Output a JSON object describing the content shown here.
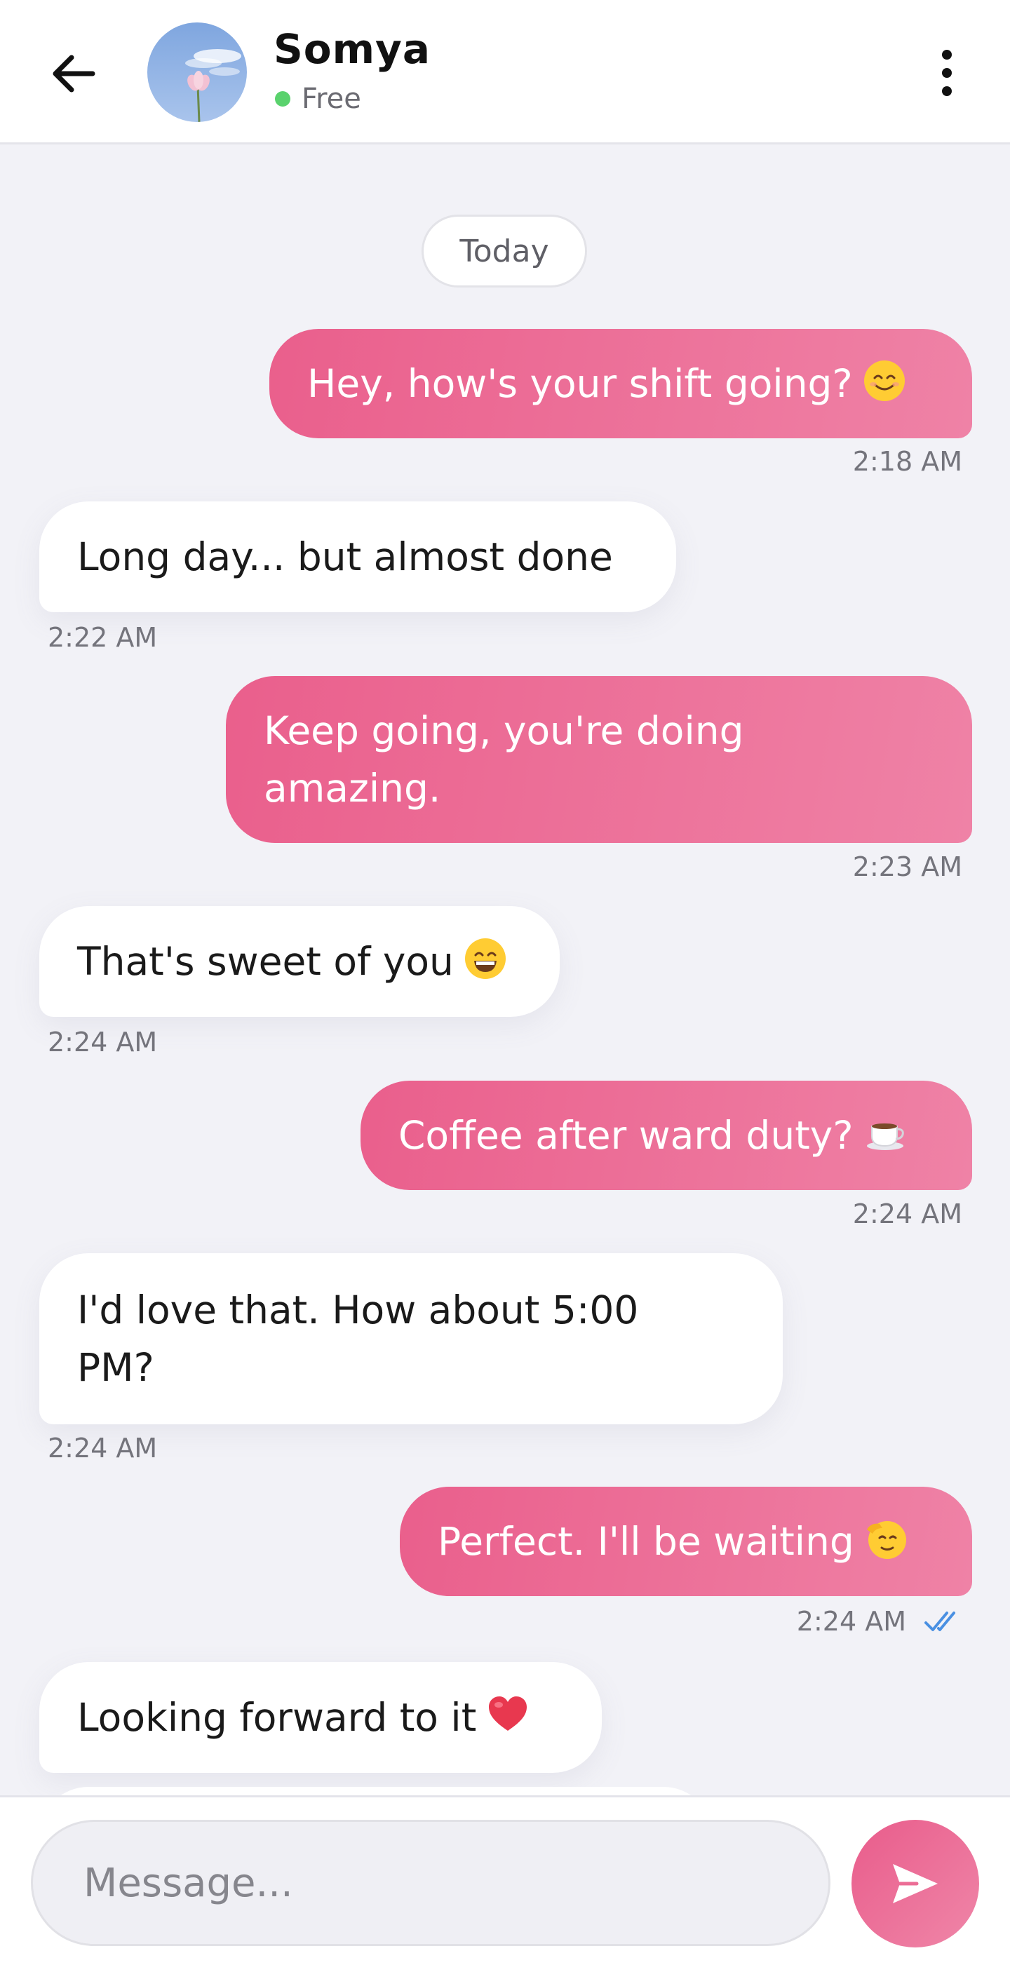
{
  "header": {
    "contact_name": "Somya",
    "status": "Free",
    "status_color": "#5ad26d"
  },
  "day_separator": "Today",
  "messages": [
    {
      "direction": "out",
      "text": "Hey, how's your shift going?",
      "emoji": "smiling-face-icon",
      "time": "2:18 AM"
    },
    {
      "direction": "in",
      "text": "Long day... but almost done",
      "time": "2:22 AM"
    },
    {
      "direction": "out",
      "text": "Keep going, you're doing amazing.",
      "time": "2:23 AM"
    },
    {
      "direction": "in",
      "text": "That's sweet of you",
      "emoji": "grinning-face-icon",
      "time": "2:24 AM"
    },
    {
      "direction": "out",
      "text": "Coffee after ward duty?",
      "emoji": "coffee-cup-icon",
      "time": "2:24 AM"
    },
    {
      "direction": "in",
      "text": "I'd love that. How about 5:00 PM?",
      "time": "2:24 AM"
    },
    {
      "direction": "out",
      "text": "Perfect. I'll be waiting",
      "emoji": "saluting-face-icon",
      "time": "2:24 AM",
      "status": "read"
    },
    {
      "direction": "in",
      "text": "Looking forward to it",
      "emoji": "red-heart-icon"
    }
  ],
  "composer": {
    "placeholder": "Message..."
  },
  "colors": {
    "accent_start": "#ea5f8c",
    "accent_end": "#ef82a6",
    "background": "#f2f2f7",
    "read_receipt": "#4a90e2"
  }
}
